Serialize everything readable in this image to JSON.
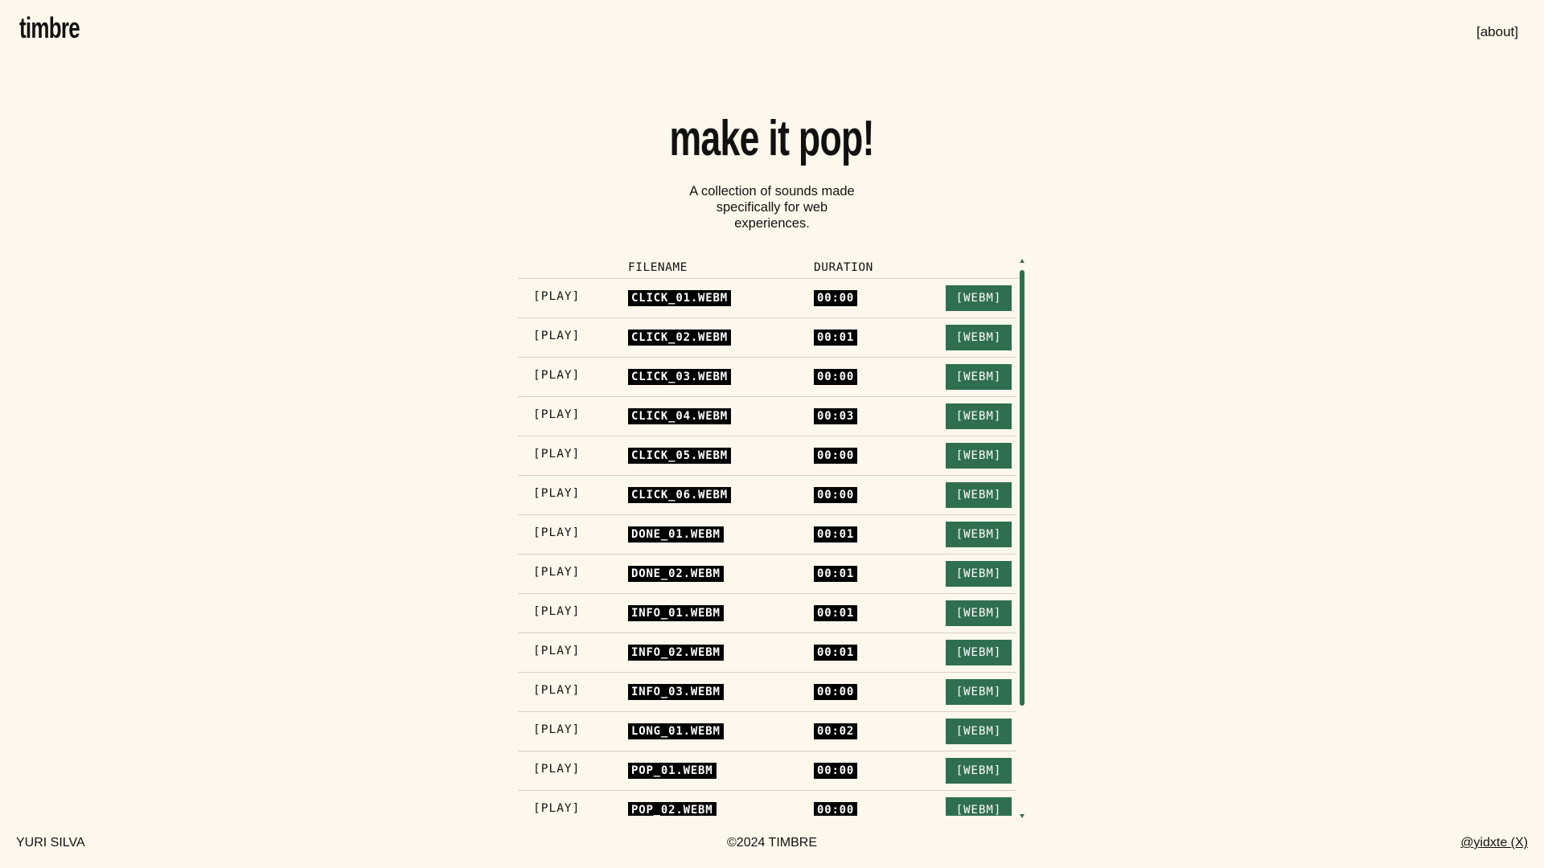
{
  "header": {
    "logo": "timbre",
    "about_link": "[about]"
  },
  "hero": {
    "title": "make it pop!",
    "subtitle": "A collection of sounds made specifically for web experiences."
  },
  "table": {
    "columns": {
      "filename": "FILENAME",
      "duration": "DURATION"
    },
    "play_label": "[PLAY]",
    "download_label": "[WEBM]",
    "rows": [
      {
        "filename": "CLICK_01.WEBM",
        "duration": "00:00"
      },
      {
        "filename": "CLICK_02.WEBM",
        "duration": "00:01"
      },
      {
        "filename": "CLICK_03.WEBM",
        "duration": "00:00"
      },
      {
        "filename": "CLICK_04.WEBM",
        "duration": "00:03"
      },
      {
        "filename": "CLICK_05.WEBM",
        "duration": "00:00"
      },
      {
        "filename": "CLICK_06.WEBM",
        "duration": "00:00"
      },
      {
        "filename": "DONE_01.WEBM",
        "duration": "00:01"
      },
      {
        "filename": "DONE_02.WEBM",
        "duration": "00:01"
      },
      {
        "filename": "INFO_01.WEBM",
        "duration": "00:01"
      },
      {
        "filename": "INFO_02.WEBM",
        "duration": "00:01"
      },
      {
        "filename": "INFO_03.WEBM",
        "duration": "00:00"
      },
      {
        "filename": "LONG_01.WEBM",
        "duration": "00:02"
      },
      {
        "filename": "POP_01.WEBM",
        "duration": "00:00"
      },
      {
        "filename": "POP_02.WEBM",
        "duration": "00:00"
      }
    ]
  },
  "footer": {
    "author": "YURI SILVA",
    "copyright": "©2024 TIMBRE",
    "social": "@yidxte (X)"
  },
  "colors": {
    "background": "#fef8ec",
    "accent": "#2f6f4f",
    "tag_bg": "#000000",
    "text": "#111111"
  },
  "icons": {
    "scroll_up": "scroll-up-arrow-icon",
    "scroll_down": "scroll-down-arrow-icon"
  }
}
